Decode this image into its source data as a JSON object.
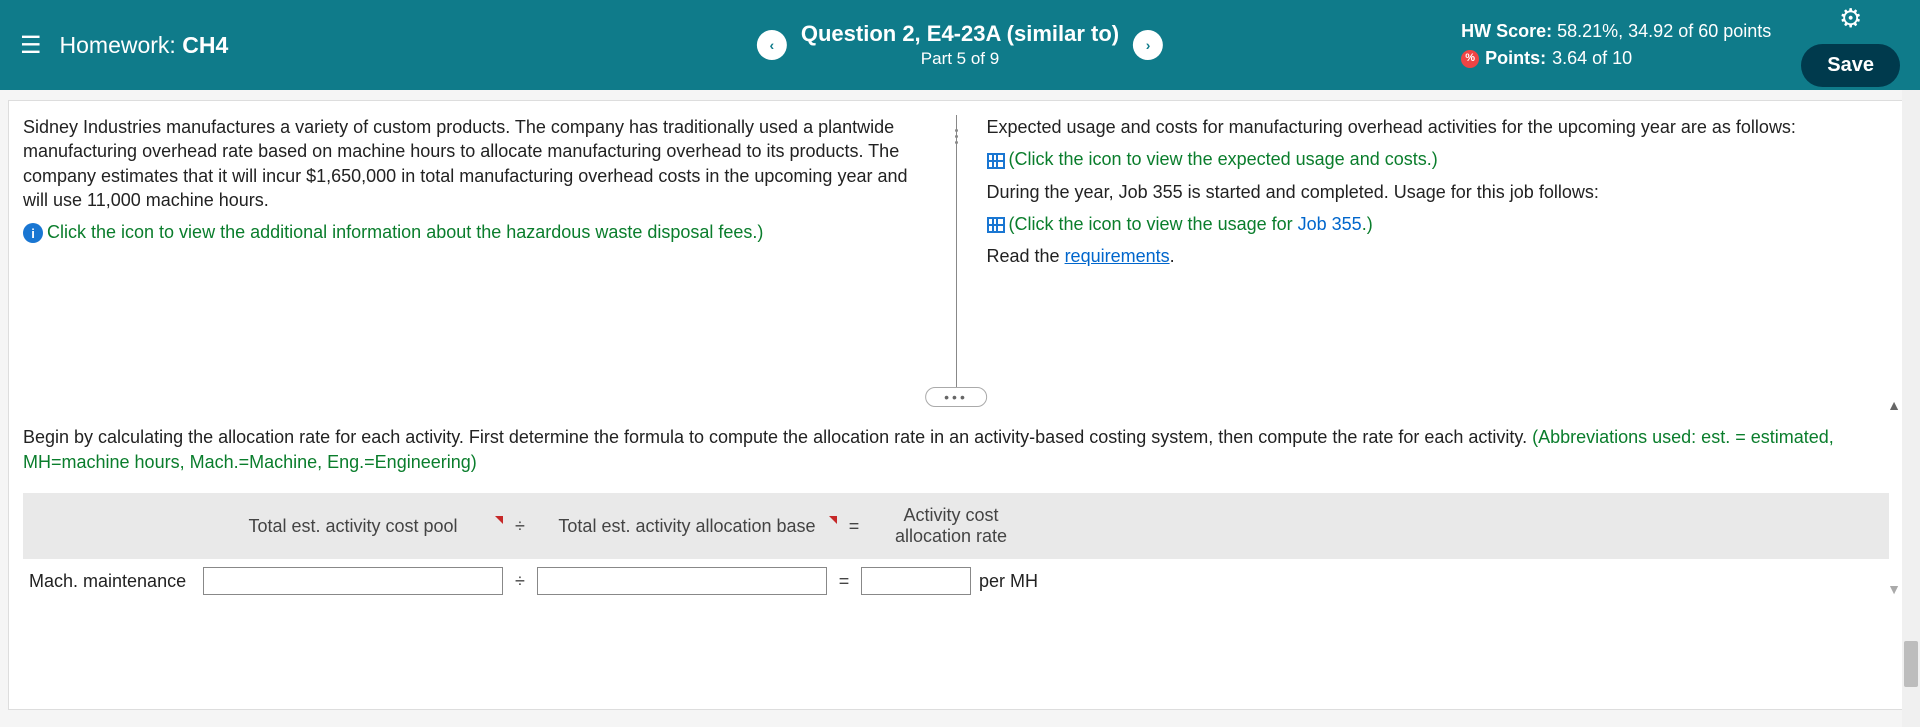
{
  "header": {
    "homework_label": "Homework:",
    "homework_name": "CH4",
    "question_title": "Question 2, E4-23A (similar to)",
    "part_label": "Part 5 of 9",
    "hw_score_label": "HW Score:",
    "hw_score_value": "58.21%, 34.92 of 60 points",
    "points_label": "Points:",
    "points_value": "3.64 of 10",
    "save_label": "Save"
  },
  "problem": {
    "left_text": "Sidney Industries manufactures a variety of custom products. The company has traditionally used a plantwide manufacturing overhead rate based on machine hours to allocate manufacturing overhead to its products. The company estimates that it will incur $1,650,000 in total manufacturing overhead costs in the upcoming year and will use 11,000 machine hours.",
    "left_link": "Click the icon to view the additional information about the hazardous waste disposal fees.)",
    "right_text1": "Expected usage and costs for manufacturing overhead activities for the upcoming year are as follows:",
    "right_link1": "(Click the icon to view the expected usage and costs.)",
    "right_text2": "During the year, Job 355 is started and completed. Usage for this job follows:",
    "right_link2": "(Click the icon to view the usage for ",
    "right_link2_job": "Job 355",
    "right_link2_end": ".)",
    "read_the": "Read the ",
    "requirements": "requirements",
    "period": "."
  },
  "bottom": {
    "instruction_main": "Begin by calculating the allocation rate for each activity. First determine the formula to compute the allocation rate in an activity-based costing system, then compute the rate for each activity. ",
    "abbreviations": "(Abbreviations used: est. = estimated, MH=machine hours, Mach.=Machine, Eng.=Engineering)",
    "hdr1": "Total est. activity cost pool",
    "hdr2": "Total est. activity allocation base",
    "hdr3": "Activity cost allocation rate",
    "op_div": "÷",
    "op_eq": "=",
    "row1_label": "Mach. maintenance",
    "row1_unit": "per MH"
  }
}
